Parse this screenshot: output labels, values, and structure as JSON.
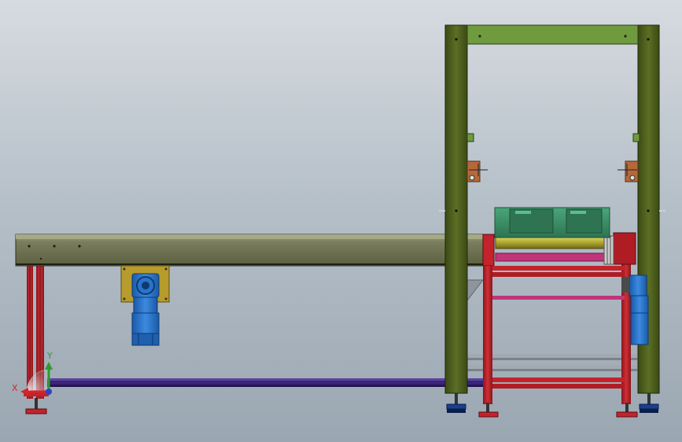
{
  "viewport": {
    "background_top": "#d6dbe0",
    "background_bottom": "#9aa6b1"
  },
  "colors": {
    "conveyor_body": "#6f7355",
    "conveyor_top": "#8a8e6c",
    "frame_red": "#c4232b",
    "frame_red_dark": "#7c1218",
    "column_green": "#566a22",
    "column_green_dark": "#2f3d10",
    "top_beam_green": "#6f9a3e",
    "motor_blue": "#2a73c8",
    "motor_blue_dark": "#154b8c",
    "mount_plate": "#b79b2c",
    "rail_purple": "#3a237a",
    "rail_grey": "#8f959c",
    "roller_yellow": "#b9b23a",
    "roller_magenta": "#c0367a",
    "crate_green": "#3f8f6a",
    "foot_blue": "#1b3f8c",
    "foot_red": "#c4232b"
  },
  "coordinate_triad": {
    "x_axis_label": "X",
    "y_axis_label": "Y",
    "x_color": "#d1262b",
    "y_color": "#2f9a2f",
    "z_color": "#2a46c2"
  },
  "parts": [
    "roller-conveyor",
    "conveyor-support-legs",
    "gear-motor-left",
    "lift-frame-columns",
    "lift-frame-top-beam",
    "lift-grippers",
    "roller-table",
    "roller-table-frame",
    "gear-motor-right",
    "crate-tote",
    "floor-rail",
    "leveling-feet"
  ]
}
